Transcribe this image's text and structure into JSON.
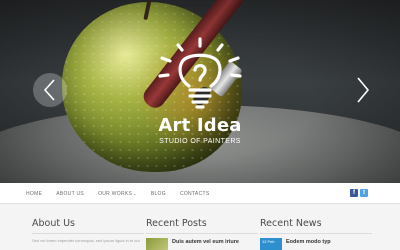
{
  "hero": {
    "title": "Art Idea",
    "subtitle": "STUDIO OF PAINTERS",
    "prev_icon": "chevron-left-icon",
    "next_icon": "chevron-right-icon",
    "logo_icon": "lightbulb-icon"
  },
  "nav": {
    "items": [
      "HOME",
      "ABOUT US",
      "OUR WORKS",
      "BLOG",
      "CONTACTS"
    ],
    "dropdown_caret": "⌄"
  },
  "social": {
    "facebook": "f",
    "twitter": "t",
    "facebook_color": "#3b5998",
    "twitter_color": "#4fa3e0"
  },
  "columns": {
    "about": {
      "title": "About Us",
      "text": "Sed vel lorem imperdiet consequat, sed ipsum ligula in et dui"
    },
    "posts": {
      "title": "Recent Posts",
      "first_title": "Duis autem vel eum iriure"
    },
    "news": {
      "title": "Recent News",
      "first_title": "Eodem modo typ",
      "first_date": "12 Feb"
    }
  },
  "colors": {
    "accent": "#2e8fcf",
    "nav_text": "#6b6b6b",
    "heading": "#4a4a4a"
  }
}
